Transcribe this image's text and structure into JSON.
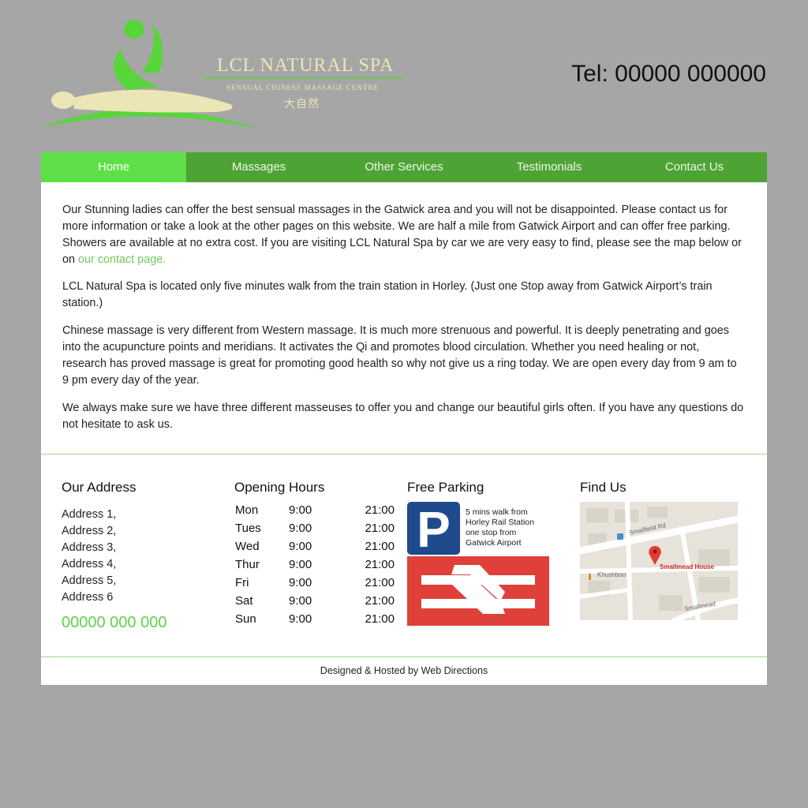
{
  "brand": {
    "name": "LCL NATURAL SPA",
    "subtitle": "SENSUAL CHINESE MASSAGE CENTRE",
    "chinese": "大自然"
  },
  "header": {
    "phone": "Tel: 00000 000000"
  },
  "nav": {
    "items": [
      {
        "label": "Home"
      },
      {
        "label": "Massages"
      },
      {
        "label": "Other Services"
      },
      {
        "label": "Testimonials"
      },
      {
        "label": "Contact Us"
      }
    ]
  },
  "content": {
    "p1": "Our Stunning ladies can offer the best sensual massages in the Gatwick area and you will not be disappointed. Please contact us for more information or take a look at the other pages on this website. We are half a mile from Gatwick Airport and can offer free parking. Showers are available at no extra cost. If you are visiting LCL Natural Spa by car we are very easy to find, please see the map below or on",
    "p1_link": "our contact page.",
    "p2": "LCL Natural Spa is located only five minutes walk from the train station in Horley. (Just one Stop away from Gatwick Airport’s train station.)",
    "p3": "Chinese massage is very different from Western massage. It is much more strenuous and powerful. It is deeply penetrating and goes into the acupuncture points and meridians. It activates the Qi and promotes blood circulation. Whether you need healing or not, research has proved massage is great for promoting good health so why not give us a ring today. We are open every day from 9 am to 9 pm every day of the year.",
    "p4": "We always make sure we have three different masseuses to offer you and change our beautiful girls often. If you have any questions do not hesitate to ask us."
  },
  "address": {
    "title": "Our Address",
    "lines": [
      "Address 1,",
      "Address 2,",
      "Address 3,",
      "Address 4,",
      "Address 5,",
      "Address 6"
    ],
    "phone": "00000 000 000"
  },
  "hours": {
    "title": "Opening Hours",
    "rows": [
      {
        "day": "Mon",
        "open": "9:00",
        "close": "21:00"
      },
      {
        "day": "Tues",
        "open": "9:00",
        "close": "21:00"
      },
      {
        "day": "Wed",
        "open": "9:00",
        "close": "21:00"
      },
      {
        "day": "Thur",
        "open": "9:00",
        "close": "21:00"
      },
      {
        "day": "Fri",
        "open": "9:00",
        "close": "21:00"
      },
      {
        "day": "Sat",
        "open": "9:00",
        "close": "21:00"
      },
      {
        "day": "Sun",
        "open": "9:00",
        "close": "21:00"
      }
    ]
  },
  "parking": {
    "title": "Free Parking",
    "sign_letter": "P",
    "lines": [
      "5 mins walk from",
      "Horley Rail Station",
      "one stop from",
      "Gatwick Airport"
    ]
  },
  "map": {
    "title": "Find Us",
    "road1": "Smallfield Rd",
    "place": "Smallmead House",
    "poi": "Khushboo",
    "road2": "Smallmead"
  },
  "footer": {
    "prefix": "Designed & Hosted by",
    "link": "Web Directions"
  },
  "colors": {
    "background": "#a6a6a6",
    "nav": "#4ea335",
    "nav_active": "#5fdf47",
    "accent": "#5fd34a",
    "parking_blue": "#1f4a8c",
    "rail_red": "#e0403a"
  },
  "icons": [
    "massage-figure-logo",
    "parking-sign-icon",
    "national-rail-icon",
    "map-pin-icon",
    "restaurant-icon",
    "bus-stop-icon"
  ]
}
